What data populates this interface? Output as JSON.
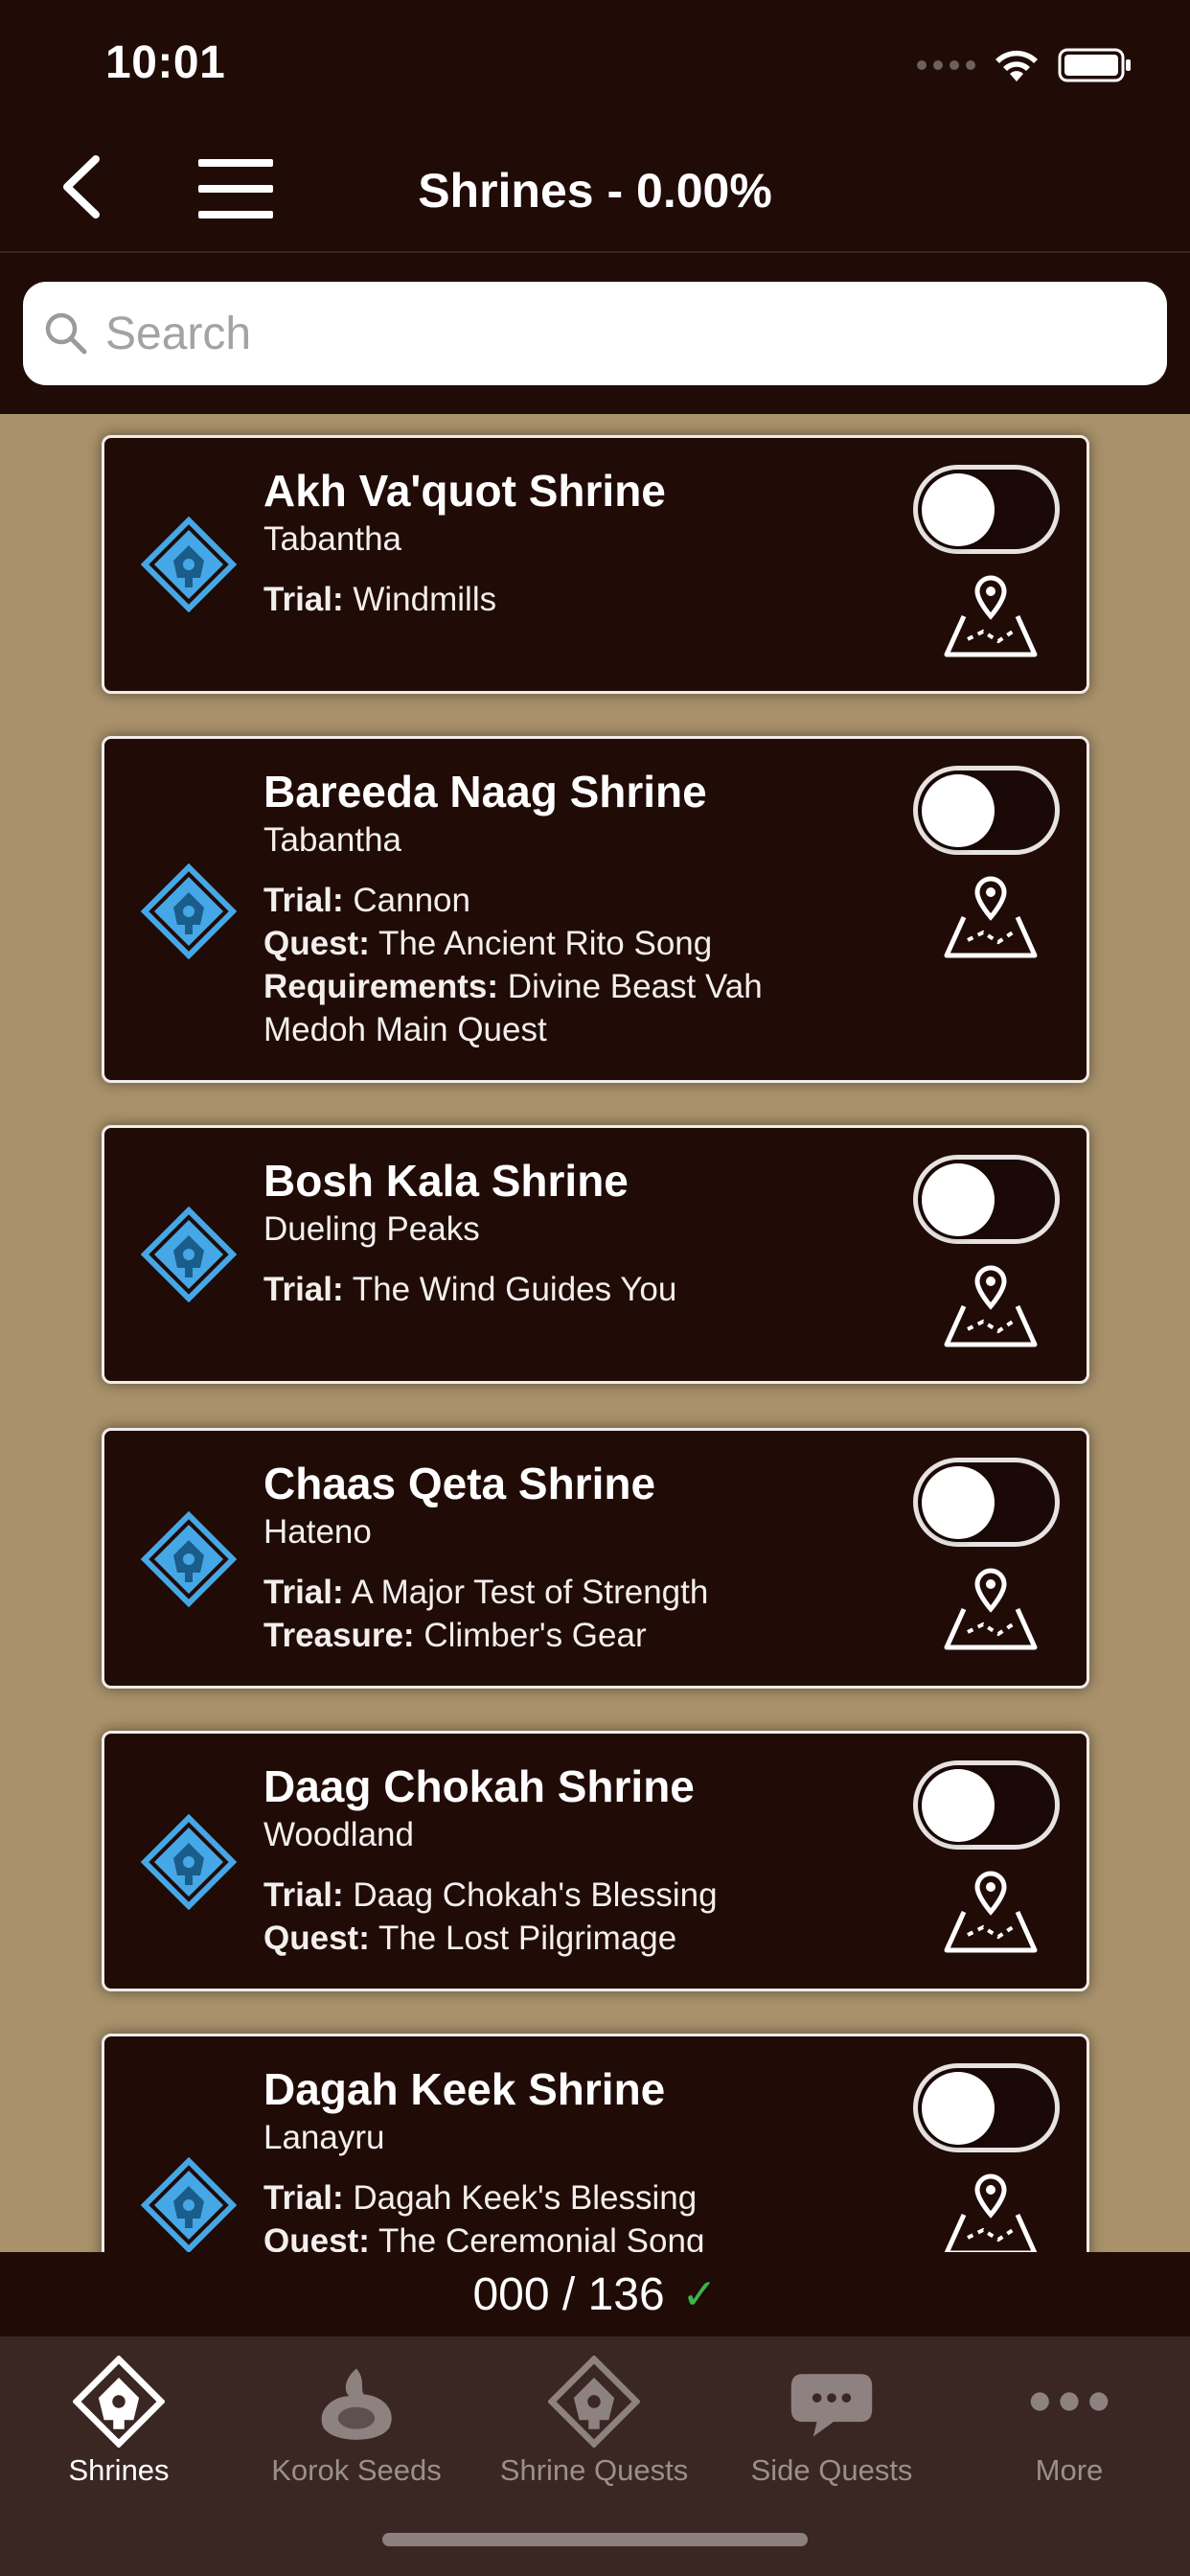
{
  "status": {
    "time": "10:01"
  },
  "nav": {
    "title": "Shrines - 0.00%"
  },
  "search": {
    "placeholder": "Search",
    "value": ""
  },
  "colors": {
    "header_bg": "#200b07",
    "list_bg": "#a8916b",
    "card_bg": "#200b07",
    "card_border": "#f1ece8",
    "shrine_icon": "#46a7e6",
    "check": "#3bb54a",
    "tabbar_bg": "#3a2622"
  },
  "shrines": [
    {
      "name": "Akh Va'quot Shrine",
      "region": "Tabantha",
      "completed": false,
      "details": [
        {
          "label": "Trial:",
          "value": "Windmills"
        }
      ]
    },
    {
      "name": "Bareeda Naag Shrine",
      "region": "Tabantha",
      "completed": false,
      "details": [
        {
          "label": "Trial:",
          "value": "Cannon"
        },
        {
          "label": "Quest:",
          "value": "The Ancient Rito Song"
        },
        {
          "label": "Requirements:",
          "value": "Divine Beast Vah Medoh Main Quest"
        }
      ]
    },
    {
      "name": "Bosh Kala Shrine",
      "region": "Dueling Peaks",
      "completed": false,
      "details": [
        {
          "label": "Trial:",
          "value": "The Wind Guides You"
        }
      ]
    },
    {
      "name": "Chaas Qeta Shrine",
      "region": "Hateno",
      "completed": false,
      "details": [
        {
          "label": "Trial:",
          "value": "A Major Test of Strength"
        },
        {
          "label": "Treasure:",
          "value": "Climber's Gear"
        }
      ]
    },
    {
      "name": "Daag Chokah Shrine",
      "region": "Woodland",
      "completed": false,
      "details": [
        {
          "label": "Trial:",
          "value": "Daag Chokah's Blessing"
        },
        {
          "label": "Quest:",
          "value": "The Lost Pilgrimage"
        }
      ]
    },
    {
      "name": "Dagah Keek Shrine",
      "region": "Lanayru",
      "completed": false,
      "details": [
        {
          "label": "Trial:",
          "value": "Dagah Keek's Blessing"
        },
        {
          "label": "Quest:",
          "value": "The Ceremonial Song"
        }
      ]
    }
  ],
  "counter": {
    "text": "000 / 136",
    "check": "✓"
  },
  "tabs": [
    {
      "label": "Shrines",
      "icon": "shrine-icon",
      "active": true
    },
    {
      "label": "Korok Seeds",
      "icon": "korok-seed-icon",
      "active": false
    },
    {
      "label": "Shrine Quests",
      "icon": "shrine-quest-icon",
      "active": false
    },
    {
      "label": "Side Quests",
      "icon": "speech-bubble-icon",
      "active": false
    },
    {
      "label": "More",
      "icon": "more-dots-icon",
      "active": false
    }
  ]
}
